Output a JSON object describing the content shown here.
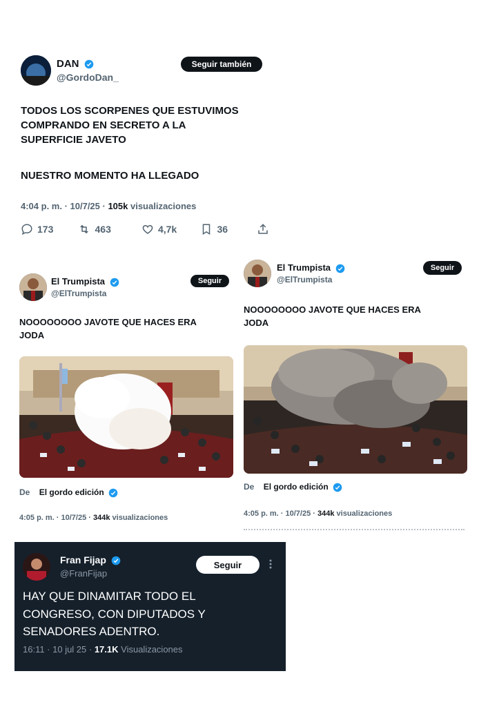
{
  "tweet_dan": {
    "name": "DAN",
    "handle": "@GordoDan_",
    "follow_label": "Seguir también",
    "text_lines": [
      "TODOS LOS SCORPENES QUE ESTUVIMOS",
      "COMPRANDO EN SECRETO A LA",
      "SUPERFICIE JAVETO"
    ],
    "text_line_2": "NUESTRO MOMENTO HA LLEGADO",
    "meta_time": "4:04 p. m. · 10/7/25 · ",
    "meta_views": "105k",
    "meta_views_label": " visualizaciones",
    "replies": "173",
    "retweets": "463",
    "likes": "4,7k",
    "bookmarks": "36"
  },
  "tweet_trump_left": {
    "name": "El Trumpista",
    "handle": "@ElTrumpista",
    "follow_label": "Seguir",
    "text_lines": [
      "NOOOOOOOO JAVOTE QUE HACES ERA",
      "JODA"
    ],
    "from_label": "De",
    "from_source": "El gordo edición",
    "meta_time": "4:05 p. m. · 10/7/25 · ",
    "meta_views": "344k",
    "meta_views_label": " visualizaciones"
  },
  "tweet_trump_right": {
    "name": "El Trumpista",
    "handle": "@ElTrumpista",
    "follow_label": "Seguir",
    "text_lines": [
      "NOOOOOOOO JAVOTE QUE HACES ERA",
      "JODA"
    ],
    "from_label": "De",
    "from_source": "El gordo edición",
    "meta_time": "4:05 p. m. · 10/7/25 · ",
    "meta_views": "344k",
    "meta_views_label": " visualizaciones"
  },
  "tweet_fran": {
    "name": "Fran Fijap",
    "handle": "@FranFijap",
    "follow_label": "Seguir",
    "text_lines": [
      "HAY QUE DINAMITAR TODO EL",
      "CONGRESO, CON DIPUTADOS Y",
      "SENADORES ADENTRO."
    ],
    "meta_time": "16:11 · 10 jul 25 · ",
    "meta_views": "17.1K",
    "meta_views_label": " Visualizaciones"
  },
  "colors": {
    "verified": "#1d9bf0",
    "dark_bg": "#15202b",
    "text": "#0f1419",
    "muted": "#536471"
  },
  "icons": [
    "reply-icon",
    "retweet-icon",
    "like-icon",
    "bookmark-icon",
    "share-icon",
    "verified-badge-icon",
    "more-options-icon"
  ]
}
